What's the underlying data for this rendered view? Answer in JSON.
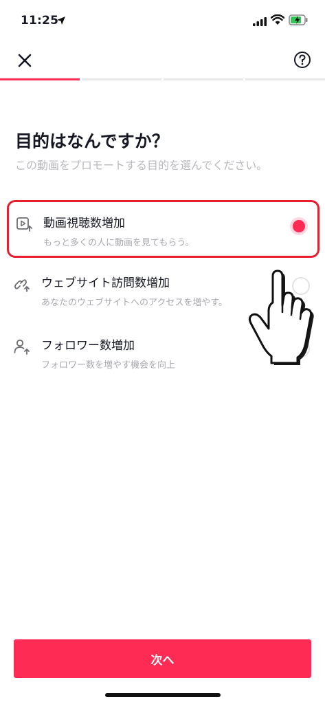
{
  "status_bar": {
    "time": "11:25"
  },
  "header": {
    "close_icon": "close-icon",
    "help_icon": "help-icon"
  },
  "progress": {
    "steps": 4,
    "current": 1,
    "accent": "#fe2c55"
  },
  "page": {
    "title": "目的はなんですか？",
    "subtitle": "この動画をプロモートする目的を選んでください。"
  },
  "options": [
    {
      "title": "動画視聴数増加",
      "description": "もっと多くの人に動画を見てもらう。",
      "icon": "video-play-icon",
      "selected": true
    },
    {
      "title": "ウェブサイト訪問数増加",
      "description": "あなたのウェブサイトへのアクセスを増やす。",
      "icon": "link-icon",
      "selected": false
    },
    {
      "title": "フォロワー数増加",
      "description": "フォロワー数を増やす機会を向上",
      "icon": "add-user-icon",
      "selected": false
    }
  ],
  "footer": {
    "next_label": "次へ",
    "button_color": "#fe2c55"
  },
  "colors": {
    "selected_border": "#e81e2e",
    "text_primary": "#161823",
    "text_secondary": "#a8a8ae"
  }
}
